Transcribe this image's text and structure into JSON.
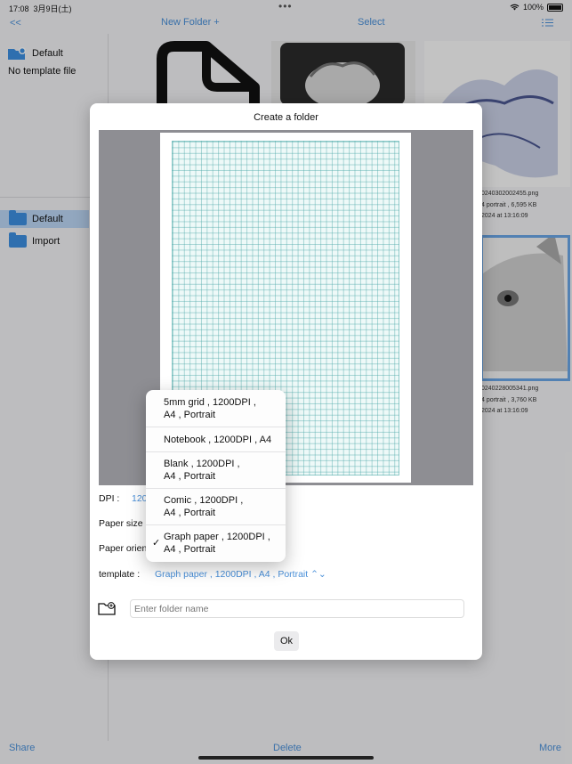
{
  "status": {
    "time": "17:08",
    "date": "3月9日(土)",
    "battery": "100%"
  },
  "toolbar": {
    "back_label": "<<",
    "new_folder_label": "New Folder +",
    "select_label": "Select"
  },
  "sidebar": {
    "top_folder": "Default",
    "no_template": "No template file",
    "items": [
      {
        "label": "Default",
        "selected": true
      },
      {
        "label": "Import",
        "selected": false
      }
    ]
  },
  "gallery": {
    "captions": [
      [
        "0240302002455.png",
        "4 portrait , 6,595 KB",
        "2024 at 13:16:09"
      ],
      [
        "0240228005341.png",
        "4 portrait , 3,760 KB",
        "2024 at 13:16:09"
      ]
    ]
  },
  "bottombar": {
    "share_label": "Share",
    "delete_label": "Delete",
    "more_label": "More"
  },
  "dialog": {
    "title": "Create a folder",
    "dpi_label": "DPI :",
    "dpi_value": "120",
    "paper_size_label": "Paper size",
    "paper_orientation_label": "Paper orien",
    "template_label": "template :",
    "template_value": "Graph paper , 1200DPI , A4 , Portrait ⌃⌄",
    "folder_name_placeholder": "Enter folder name",
    "ok_label": "Ok"
  },
  "template_menu": [
    {
      "line1": "5mm grid , 1200DPI ,",
      "line2": "A4 , Portrait",
      "checked": false
    },
    {
      "line1": "Notebook , 1200DPI , A4",
      "line2": "",
      "checked": false
    },
    {
      "line1": "Blank , 1200DPI ,",
      "line2": "A4 , Portrait",
      "checked": false
    },
    {
      "line1": "Comic , 1200DPI ,",
      "line2": "A4 , Portrait",
      "checked": false
    },
    {
      "line1": "Graph paper , 1200DPI ,",
      "line2": "A4 , Portrait",
      "checked": true
    }
  ],
  "colors": {
    "accent": "#4a90d9",
    "folder": "#3d8fe0",
    "selected_row": "#bcd6f5",
    "grid_line": "#50aaaa"
  }
}
